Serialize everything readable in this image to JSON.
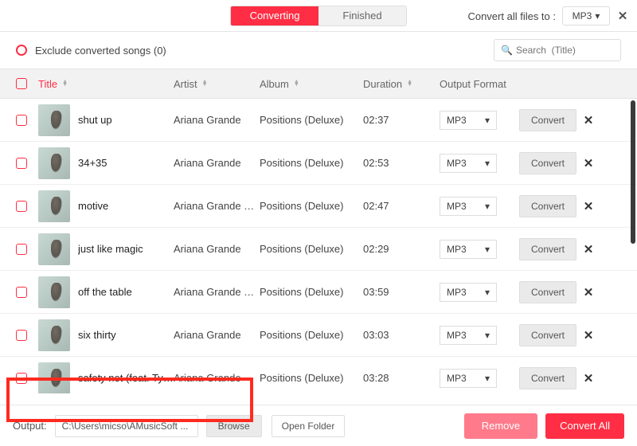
{
  "topbar": {
    "tabs": {
      "converting": "Converting",
      "finished": "Finished"
    },
    "convert_all_label": "Convert all files to :",
    "global_format": "MP3"
  },
  "filter": {
    "exclude_label": "Exclude converted songs (0)",
    "search_placeholder": "Search  (Title)"
  },
  "columns": {
    "title": "Title",
    "artist": "Artist",
    "album": "Album",
    "duration": "Duration",
    "output_format": "Output Format"
  },
  "buttons": {
    "convert": "Convert",
    "browse": "Browse",
    "open_folder": "Open Folder",
    "remove": "Remove",
    "convert_all": "Convert All"
  },
  "output": {
    "label": "Output:",
    "path": "C:\\Users\\micso\\AMusicSoft ..."
  },
  "row_format_default": "MP3",
  "tracks": [
    {
      "title": "shut up",
      "artist": "Ariana Grande",
      "album": "Positions (Deluxe)",
      "duration": "02:37"
    },
    {
      "title": "34+35",
      "artist": "Ariana Grande",
      "album": "Positions (Deluxe)",
      "duration": "02:53"
    },
    {
      "title": "motive",
      "artist": "Ariana Grande & ...",
      "album": "Positions (Deluxe)",
      "duration": "02:47"
    },
    {
      "title": "just like magic",
      "artist": "Ariana Grande",
      "album": "Positions (Deluxe)",
      "duration": "02:29"
    },
    {
      "title": "off the table",
      "artist": "Ariana Grande & ...",
      "album": "Positions (Deluxe)",
      "duration": "03:59"
    },
    {
      "title": "six thirty",
      "artist": "Ariana Grande",
      "album": "Positions (Deluxe)",
      "duration": "03:03"
    },
    {
      "title": "safety net (feat. Ty ...",
      "artist": "Ariana Grande",
      "album": "Positions (Deluxe)",
      "duration": "03:28"
    }
  ]
}
